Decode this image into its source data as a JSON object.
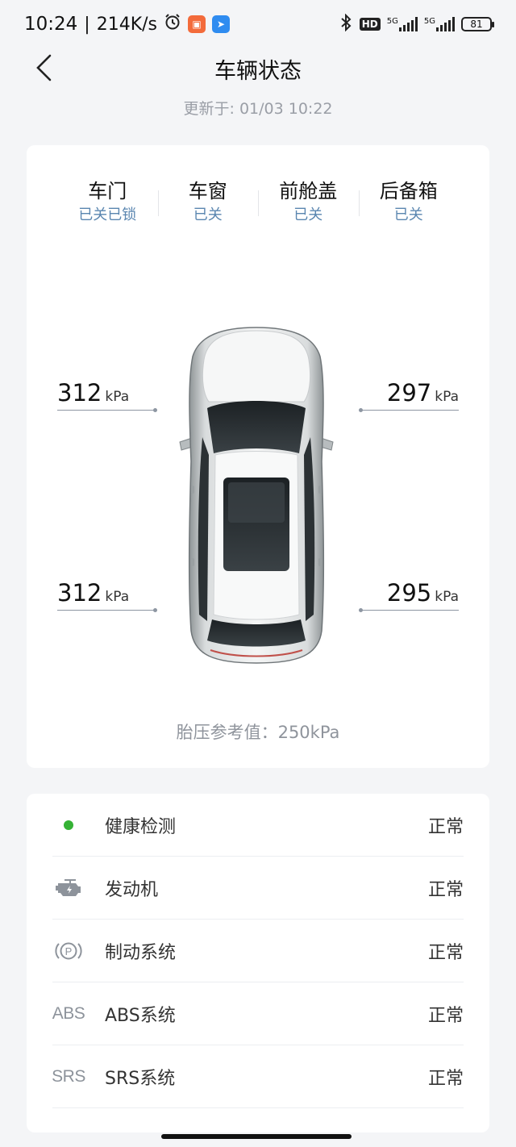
{
  "status_bar": {
    "time": "10:24",
    "speed": "214K/s",
    "battery": "81",
    "net1": "5G",
    "net2": "5G",
    "hd": "HD"
  },
  "header": {
    "title": "车辆状态",
    "update_time": "更新于: 01/03 10:22"
  },
  "vehicle_status": [
    {
      "name": "车门",
      "value": "已关已锁"
    },
    {
      "name": "车窗",
      "value": "已关"
    },
    {
      "name": "前舱盖",
      "value": "已关"
    },
    {
      "name": "后备箱",
      "value": "已关"
    }
  ],
  "tires": {
    "front_left": {
      "value": "312",
      "unit": "kPa"
    },
    "front_right": {
      "value": "297",
      "unit": "kPa"
    },
    "rear_left": {
      "value": "312",
      "unit": "kPa"
    },
    "rear_right": {
      "value": "295",
      "unit": "kPa"
    },
    "reference": "胎压参考值：250kPa"
  },
  "health": [
    {
      "icon": "green-dot-icon",
      "label": "健康检测",
      "value": "正常"
    },
    {
      "icon": "engine-icon",
      "label": "发动机",
      "value": "正常"
    },
    {
      "icon": "parking-brake-icon",
      "label": "制动系统",
      "value": "正常"
    },
    {
      "icon": "abs-icon",
      "icon_text": "ABS",
      "label": "ABS系统",
      "value": "正常"
    },
    {
      "icon": "srs-icon",
      "icon_text": "SRS",
      "label": "SRS系统",
      "value": "正常"
    }
  ],
  "colors": {
    "status_blue": "#5a86b0",
    "ok_green": "#35b235",
    "background": "#f4f5f7"
  }
}
